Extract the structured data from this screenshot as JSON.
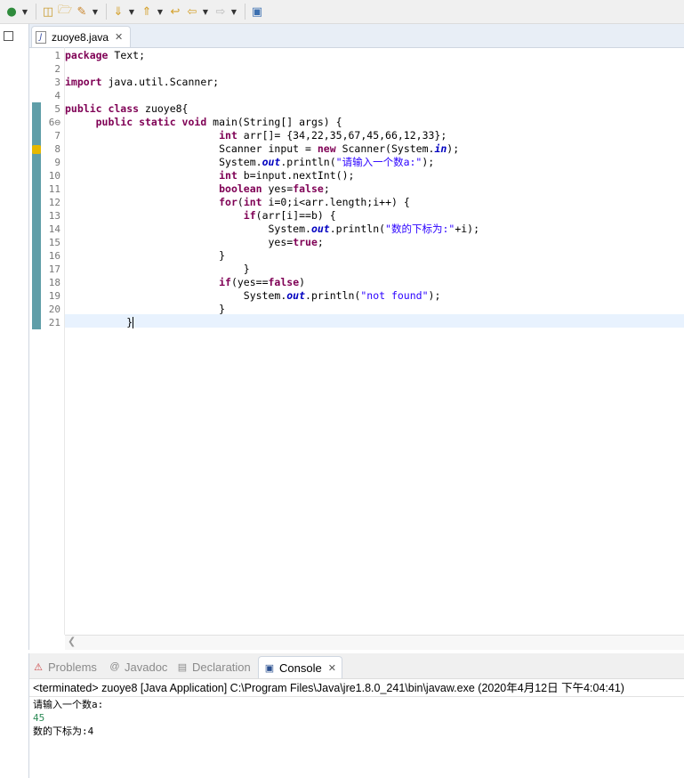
{
  "toolbar": {
    "icons": [
      "run-icon",
      "dropdown-arrow",
      "open-type-icon",
      "open-folder-icon",
      "search-icon",
      "dropdown-arrow",
      "next-annotation-icon",
      "dropdown-arrow",
      "prev-annotation-icon",
      "dropdown-arrow",
      "last-edit-icon",
      "back-icon",
      "dropdown-arrow",
      "forward-icon",
      "dropdown-arrow",
      "pin-editor-icon"
    ]
  },
  "editor": {
    "tab_label": "zuoye8.java",
    "line_numbers": [
      "1",
      "2",
      "3",
      "4",
      "5",
      "6⊖",
      "7",
      "8",
      "9",
      "10",
      "11",
      "12",
      "13",
      "14",
      "15",
      "16",
      "17",
      "18",
      "19",
      "20",
      "21"
    ]
  },
  "code": {
    "l1_kw": "package",
    "l1_rest": " Text;",
    "l3_kw": "import",
    "l3_rest": " java.util.Scanner;",
    "l5_kw": "public class",
    "l5_rest": " zuoye8{",
    "l6_indent": "     ",
    "l6_kw": "public static void",
    "l6_rest": " main(String[] args) {",
    "l7_indent": "                         ",
    "l7_kw": "int",
    "l7_rest": " arr[]= {34,22,35,67,45,66,12,33};",
    "l8_a": "                         Scanner input = ",
    "l8_kw": "new",
    "l8_b": " Scanner(System.",
    "l8_fld": "in",
    "l8_c": ");",
    "l9_a": "                         System.",
    "l9_fld": "out",
    "l9_b": ".println(",
    "l9_str": "\"请输入一个数a:\"",
    "l9_c": ");",
    "l10_indent": "                         ",
    "l10_kw": "int",
    "l10_rest": " b=input.nextInt();",
    "l11_indent": "                         ",
    "l11_kw": "boolean",
    "l11_a": " yes=",
    "l11_kw2": "false",
    "l11_b": ";",
    "l12_indent": "                         ",
    "l12_kw": "for",
    "l12_a": "(",
    "l12_kw2": "int",
    "l12_b": " i=0;i<arr.length;i++) {",
    "l13_indent": "                             ",
    "l13_kw": "if",
    "l13_rest": "(arr[i]==b) {",
    "l14_a": "                                 System.",
    "l14_fld": "out",
    "l14_b": ".println(",
    "l14_str": "\"数的下标为:\"",
    "l14_c": "+i);",
    "l15_a": "                                 yes=",
    "l15_kw": "true",
    "l15_b": ";",
    "l16_text": "                         }",
    "l17_text": "                             }",
    "l18_indent": "                         ",
    "l18_kw": "if",
    "l18_a": "(yes==",
    "l18_kw2": "false",
    "l18_b": ")",
    "l19_a": "                             System.",
    "l19_fld": "out",
    "l19_b": ".println(",
    "l19_str": "\"not found\"",
    "l19_c": ");",
    "l20_text": "                         }",
    "l21_text": "          }"
  },
  "console": {
    "tabs": [
      {
        "label": "Problems",
        "icon": "problems-icon"
      },
      {
        "label": "Javadoc",
        "icon": "javadoc-icon"
      },
      {
        "label": "Declaration",
        "icon": "declaration-icon"
      },
      {
        "label": "Console",
        "icon": "console-icon"
      }
    ],
    "terminated": "<terminated> zuoye8 [Java Application] C:\\Program Files\\Java\\jre1.8.0_241\\bin\\javaw.exe (2020年4月12日 下午4:04:41)",
    "output": [
      "请输入一个数a:",
      "45",
      "数的下标为:4"
    ],
    "input_color": "#2e8b57"
  },
  "colors": {
    "keyword": "#7f0055",
    "string": "#2a00ff",
    "field": "#0000c0",
    "current_line": "#e8f2fe"
  }
}
